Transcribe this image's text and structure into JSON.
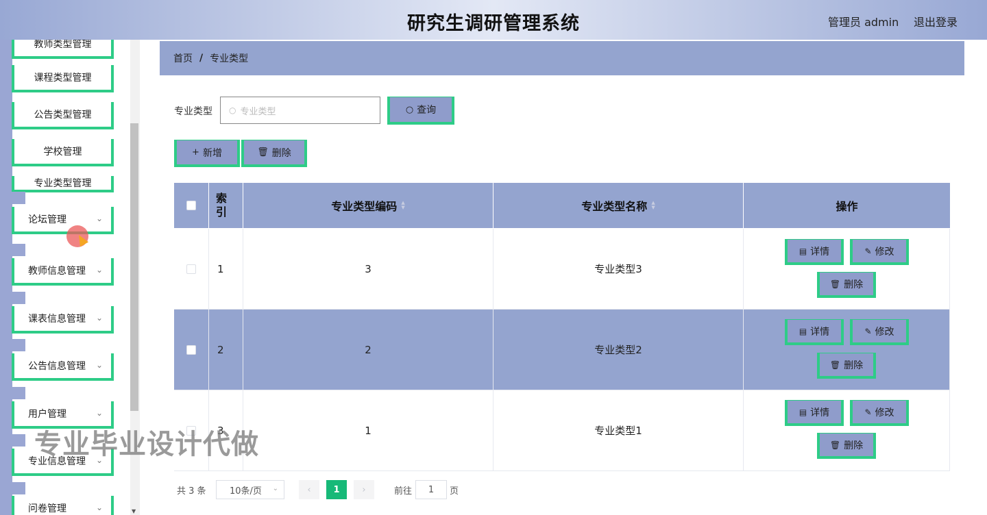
{
  "header": {
    "title": "研究生调研管理系统",
    "user": "管理员 admin",
    "logout": "退出登录"
  },
  "sidebar": {
    "sub_items": [
      "教师类型管理",
      "课程类型管理",
      "公告类型管理",
      "学校管理",
      "专业类型管理"
    ],
    "menus": [
      "论坛管理",
      "教师信息管理",
      "课表信息管理",
      "公告信息管理",
      "用户管理",
      "专业信息管理",
      "问卷管理"
    ]
  },
  "breadcrumb": {
    "home": "首页",
    "separator": "/",
    "current": "专业类型"
  },
  "search": {
    "label": "专业类型",
    "placeholder": "专业类型",
    "button": "查询"
  },
  "actions": {
    "add": "新增",
    "delete": "删除"
  },
  "table": {
    "headers": {
      "index": "索引",
      "code": "专业类型编码",
      "name": "专业类型名称",
      "ops": "操作"
    },
    "rows": [
      {
        "index": "1",
        "code": "3",
        "name": "专业类型3"
      },
      {
        "index": "2",
        "code": "2",
        "name": "专业类型2"
      },
      {
        "index": "3",
        "code": "1",
        "name": "专业类型1"
      }
    ],
    "row_actions": {
      "detail": "详情",
      "edit": "修改",
      "delete": "删除"
    }
  },
  "pagination": {
    "total": "共 3 条",
    "page_size": "10条/页",
    "current": "1",
    "goto_label": "前往",
    "goto_value": "1",
    "unit": "页"
  },
  "watermark": "专业毕业设计代做",
  "colors": {
    "accent_green": "#2ecc87",
    "header_blue": "#94a4cf",
    "page_active": "#17b978"
  }
}
